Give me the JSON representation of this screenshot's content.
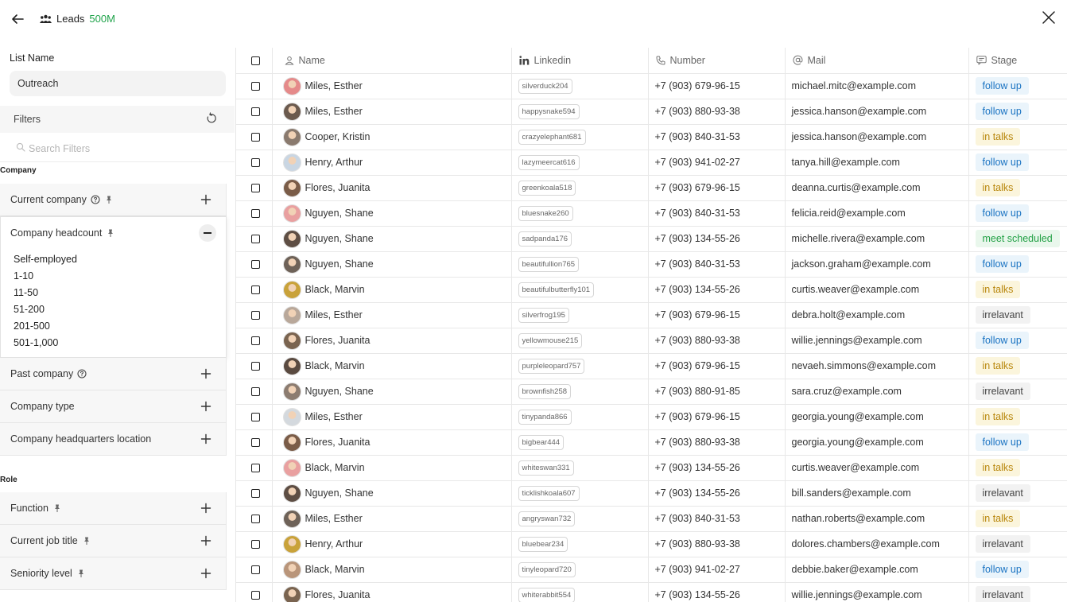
{
  "header": {
    "title": "Leads",
    "count": "500M"
  },
  "sidebar": {
    "list_name_label": "List Name",
    "list_name_value": "Outreach",
    "filters_label": "Filters",
    "search_placeholder": "Search Filters",
    "sections": {
      "company": "Company",
      "role": "Role"
    },
    "company_filters": {
      "current_company": "Current company",
      "company_headcount": "Company headcount",
      "past_company": "Past company",
      "company_type": "Company type",
      "company_hq_location": "Company headquarters location"
    },
    "headcount_options": [
      "Self-employed",
      "1-10",
      "11-50",
      "51-200",
      "201-500",
      "501-1,000"
    ],
    "role_filters": {
      "function": "Function",
      "current_job_title": "Current job title",
      "seniority_level": "Seniority level"
    }
  },
  "table": {
    "columns": {
      "name": "Name",
      "linkedin": "Linkedin",
      "number": "Number",
      "mail": "Mail",
      "stage": "Stage"
    },
    "rows": [
      {
        "name": "Miles, Esther",
        "linkedin": "silverduck204",
        "number": "+7 (903) 679-96-15",
        "mail": "michael.mitc@example.com",
        "stage": "follow up",
        "stage_kind": "follow",
        "avatar_color": "#e58a8a"
      },
      {
        "name": "Miles, Esther",
        "linkedin": "happysnake594",
        "number": "+7 (903) 880-93-38",
        "mail": "jessica.hanson@example.com",
        "stage": "follow up",
        "stage_kind": "follow",
        "avatar_color": "#6b5a4e"
      },
      {
        "name": "Cooper, Kristin",
        "linkedin": "crazyelephant681",
        "number": "+7 (903) 840-31-53",
        "mail": "jessica.hanson@example.com",
        "stage": "in talks",
        "stage_kind": "talks",
        "avatar_color": "#8a7a6e"
      },
      {
        "name": "Henry, Arthur",
        "linkedin": "lazymeercat616",
        "number": "+7 (903) 941-02-27",
        "mail": "tanya.hill@example.com",
        "stage": "follow up",
        "stage_kind": "follow",
        "avatar_color": "#c9d6e3"
      },
      {
        "name": "Flores, Juanita",
        "linkedin": "greenkoala518",
        "number": "+7 (903) 679-96-15",
        "mail": "deanna.curtis@example.com",
        "stage": "in talks",
        "stage_kind": "talks",
        "avatar_color": "#7a5c48"
      },
      {
        "name": "Nguyen, Shane",
        "linkedin": "bluesnake260",
        "number": "+7 (903) 840-31-53",
        "mail": "felicia.reid@example.com",
        "stage": "follow up",
        "stage_kind": "follow",
        "avatar_color": "#e9a0a0"
      },
      {
        "name": "Nguyen, Shane",
        "linkedin": "sadpanda176",
        "number": "+7 (903) 134-55-26",
        "mail": "michelle.rivera@example.com",
        "stage": "meet scheduled",
        "stage_kind": "meet",
        "avatar_color": "#5e4e44"
      },
      {
        "name": "Nguyen, Shane",
        "linkedin": "beautifullion765",
        "number": "+7 (903) 840-31-53",
        "mail": "jackson.graham@example.com",
        "stage": "follow up",
        "stage_kind": "follow",
        "avatar_color": "#6e6258"
      },
      {
        "name": "Black, Marvin",
        "linkedin": "beautifulbutterfly101",
        "number": "+7 (903) 134-55-26",
        "mail": "curtis.weaver@example.com",
        "stage": "in talks",
        "stage_kind": "talks",
        "avatar_color": "#c9a23a"
      },
      {
        "name": "Miles, Esther",
        "linkedin": "silverfrog195",
        "number": "+7 (903) 679-96-15",
        "mail": "debra.holt@example.com",
        "stage": "irrelavant",
        "stage_kind": "irr",
        "avatar_color": "#b9a89a"
      },
      {
        "name": "Flores, Juanita",
        "linkedin": "yellowmouse215",
        "number": "+7 (903) 880-93-38",
        "mail": "willie.jennings@example.com",
        "stage": "follow up",
        "stage_kind": "follow",
        "avatar_color": "#7a6450"
      },
      {
        "name": "Black, Marvin",
        "linkedin": "purpleleopard757",
        "number": "+7 (903) 679-96-15",
        "mail": "nevaeh.simmons@example.com",
        "stage": "in talks",
        "stage_kind": "talks",
        "avatar_color": "#5a4a40"
      },
      {
        "name": "Nguyen, Shane",
        "linkedin": "brownfish258",
        "number": "+7 (903) 880-91-85",
        "mail": "sara.cruz@example.com",
        "stage": "irrelavant",
        "stage_kind": "irr",
        "avatar_color": "#8c7c70"
      },
      {
        "name": "Miles, Esther",
        "linkedin": "tinypanda866",
        "number": "+7 (903) 679-96-15",
        "mail": "georgia.young@example.com",
        "stage": "in talks",
        "stage_kind": "talks",
        "avatar_color": "#d4d9de"
      },
      {
        "name": "Flores, Juanita",
        "linkedin": "bigbear444",
        "number": "+7 (903) 880-93-38",
        "mail": "georgia.young@example.com",
        "stage": "follow up",
        "stage_kind": "follow",
        "avatar_color": "#7a5c48"
      },
      {
        "name": "Black, Marvin",
        "linkedin": "whiteswan331",
        "number": "+7 (903) 134-55-26",
        "mail": "curtis.weaver@example.com",
        "stage": "in talks",
        "stage_kind": "talks",
        "avatar_color": "#e9a0a0"
      },
      {
        "name": "Nguyen, Shane",
        "linkedin": "ticklishkoala607",
        "number": "+7 (903) 134-55-26",
        "mail": "bill.sanders@example.com",
        "stage": "irrelavant",
        "stage_kind": "irr",
        "avatar_color": "#5e4e44"
      },
      {
        "name": "Miles, Esther",
        "linkedin": "angryswan732",
        "number": "+7 (903) 840-31-53",
        "mail": "nathan.roberts@example.com",
        "stage": "in talks",
        "stage_kind": "talks",
        "avatar_color": "#6e6258"
      },
      {
        "name": "Henry, Arthur",
        "linkedin": "bluebear234",
        "number": "+7 (903) 880-93-38",
        "mail": "dolores.chambers@example.com",
        "stage": "irrelavant",
        "stage_kind": "irr",
        "avatar_color": "#c9a23a"
      },
      {
        "name": "Black, Marvin",
        "linkedin": "tinyleopard720",
        "number": "+7 (903) 941-02-27",
        "mail": "debbie.baker@example.com",
        "stage": "follow up",
        "stage_kind": "follow",
        "avatar_color": "#b9957a"
      },
      {
        "name": "Flores, Juanita",
        "linkedin": "whiterabbit554",
        "number": "+7 (903) 134-55-26",
        "mail": "willie.jennings@example.com",
        "stage": "irrelavant",
        "stage_kind": "irr",
        "avatar_color": "#7a6450"
      }
    ]
  },
  "colors": {
    "accent_green": "#1fa34a",
    "follow_up": "#1a73c2",
    "in_talks": "#b8860b",
    "meet_scheduled": "#22a045"
  }
}
